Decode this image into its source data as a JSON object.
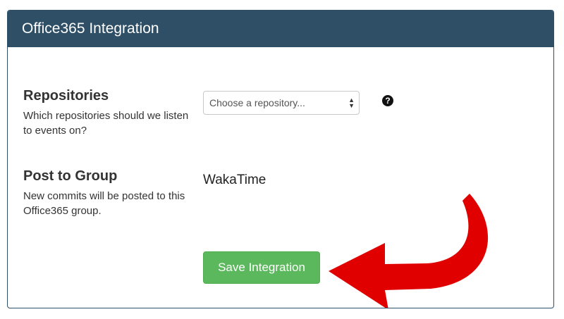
{
  "panel": {
    "title": "Office365 Integration"
  },
  "repositories": {
    "label": "Repositories",
    "description": "Which repositories should we listen to events on?",
    "select_placeholder": "Choose a repository...",
    "help_icon": "question-circle-icon"
  },
  "post_to_group": {
    "label": "Post to Group",
    "description": "New commits will be posted to this Office365 group.",
    "value": "WakaTime"
  },
  "actions": {
    "save_label": "Save Integration"
  },
  "colors": {
    "header_bg": "#2f4f66",
    "save_button": "#5cb85c",
    "annotation_arrow": "#e00000"
  }
}
